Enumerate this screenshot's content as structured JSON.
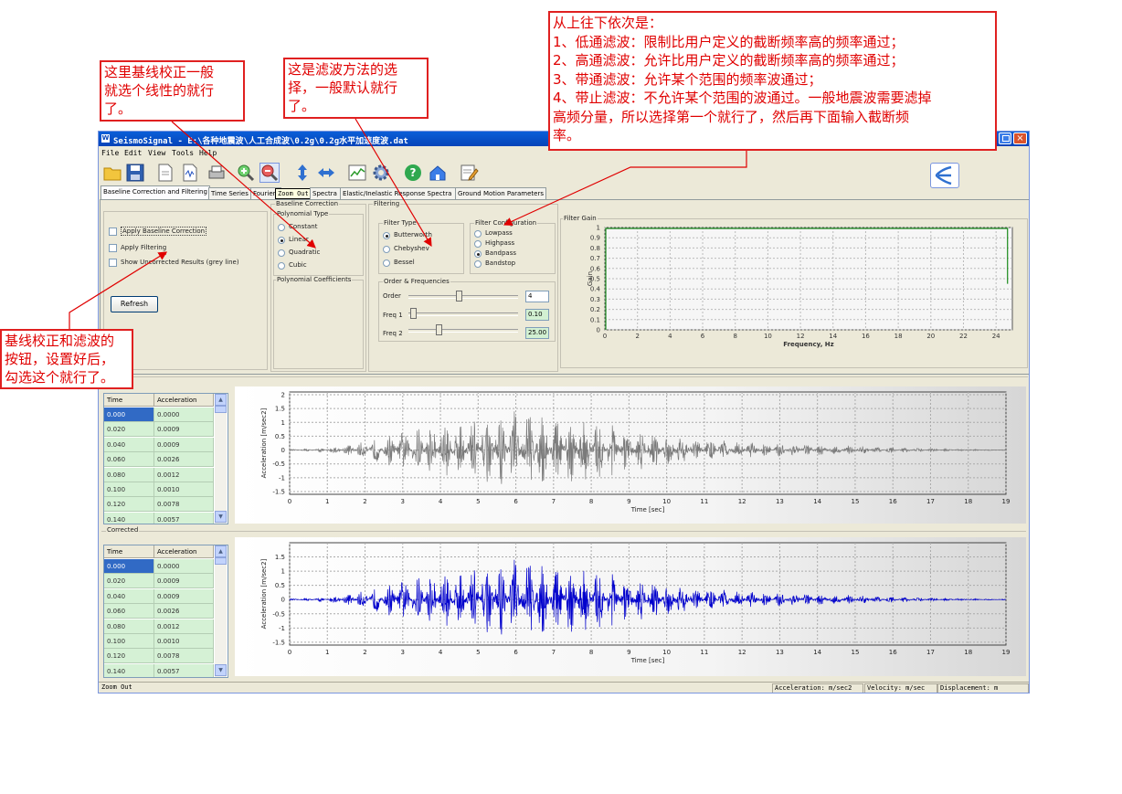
{
  "window": {
    "title": "SeismoSignal - E:\\各种地震波\\人工合成波\\0.2g\\0.2g水平加速度波.dat",
    "app_icon": "W"
  },
  "menu": [
    "File",
    "Edit",
    "View",
    "Tools",
    "Help"
  ],
  "toolbar_icons": [
    "open-folder-icon",
    "save-icon",
    "new-document-icon",
    "export-icon",
    "print-icon",
    "zoom-in-icon",
    "zoom-out-icon",
    "vertical-arrows-icon",
    "horizontal-arrows-icon",
    "chart-icon",
    "gear-icon",
    "help-icon",
    "home-icon",
    "notes-icon"
  ],
  "tabs": [
    "Baseline Correction and Filtering",
    "Time Series",
    "Fourier",
    "Zoom Out",
    "Spectra",
    "Elastic/Inelastic Response Spectra",
    "Ground Motion Parameters"
  ],
  "options": {
    "apply_baseline": "Apply Baseline Correction",
    "apply_filtering": "Apply Filtering",
    "show_uncorrected": "Show Uncorrected Results (grey line)",
    "refresh": "Refresh"
  },
  "baseline": {
    "group": "Baseline Correction",
    "poly_type": "Polynomial Type",
    "types": [
      "Constant",
      "Linear",
      "Quadratic",
      "Cubic"
    ],
    "selected": "Linear",
    "coefficients": "Polynomial Coefficients"
  },
  "filtering": {
    "group": "Filtering",
    "filter_type": "Filter Type",
    "types": [
      "Butterworth",
      "Chebyshev",
      "Bessel"
    ],
    "selected_type": "Butterworth",
    "config": "Filter Configuration",
    "configs": [
      "Lowpass",
      "Highpass",
      "Bandpass",
      "Bandstop"
    ],
    "selected_config": "Bandpass",
    "order_freq": "Order & Frequencies",
    "order_label": "Order",
    "order_value": "4",
    "freq1_label": "Freq 1",
    "freq1_value": "0.10",
    "freq2_label": "Freq 2",
    "freq2_value": "25.00"
  },
  "filter_gain": {
    "group": "Filter Gain",
    "ylabel": "Gain",
    "xlabel": "Frequency, Hz",
    "yticks": [
      "1",
      "0.9",
      "0.8",
      "0.7",
      "0.6",
      "0.5",
      "0.4",
      "0.3",
      "0.2",
      "0.1",
      "0"
    ],
    "xticks": [
      "0",
      "2",
      "4",
      "6",
      "8",
      "10",
      "12",
      "14",
      "16",
      "18",
      "20",
      "22",
      "24"
    ]
  },
  "table": {
    "headers": [
      "Time",
      "Acceleration"
    ],
    "rows": [
      [
        "0.000",
        "0.0000"
      ],
      [
        "0.020",
        "0.0009"
      ],
      [
        "0.040",
        "0.0009"
      ],
      [
        "0.060",
        "0.0026"
      ],
      [
        "0.080",
        "0.0012"
      ],
      [
        "0.100",
        "0.0010"
      ],
      [
        "0.120",
        "0.0078"
      ],
      [
        "0.140",
        "0.0057"
      ]
    ]
  },
  "corrected_label": "Corrected",
  "chart_data": [
    {
      "type": "line",
      "series_color": "#7a7a7a",
      "xlabel": "Time [sec]",
      "ylabel": "Acceleration [m/sec2]",
      "xlim": [
        0,
        19
      ],
      "ylim": [
        -1.6,
        2.1
      ],
      "xticks": [
        "0",
        "1",
        "2",
        "3",
        "4",
        "5",
        "6",
        "7",
        "8",
        "9",
        "10",
        "11",
        "12",
        "13",
        "14",
        "15",
        "16",
        "17",
        "18",
        "19"
      ],
      "yticks": [
        "2",
        "1.5",
        "1",
        "0.5",
        "0",
        "-0.5",
        "-1",
        "-1.5"
      ],
      "envelope": {
        "x": [
          0,
          1,
          2,
          3,
          4,
          5,
          6,
          7,
          8,
          9,
          10,
          11,
          12,
          13,
          14,
          15,
          16,
          17,
          18,
          19
        ],
        "amp": [
          0.02,
          0.08,
          0.3,
          0.7,
          1.0,
          1.2,
          1.5,
          1.2,
          1.1,
          0.8,
          0.6,
          0.4,
          0.3,
          0.25,
          0.2,
          0.15,
          0.1,
          0.06,
          0.03,
          0.01
        ]
      }
    },
    {
      "type": "line",
      "series_color": "#0000cc",
      "xlabel": "Time [sec]",
      "ylabel": "Acceleration [m/sec2]",
      "xlim": [
        0,
        19
      ],
      "ylim": [
        -1.6,
        2.0
      ],
      "xticks": [
        "0",
        "1",
        "2",
        "3",
        "4",
        "5",
        "6",
        "7",
        "8",
        "9",
        "10",
        "11",
        "12",
        "13",
        "14",
        "15",
        "16",
        "17",
        "18",
        "19"
      ],
      "yticks": [
        "1.5",
        "1",
        "0.5",
        "0",
        "-0.5",
        "-1",
        "-1.5"
      ],
      "envelope": {
        "x": [
          0,
          1,
          2,
          3,
          4,
          5,
          6,
          7,
          8,
          9,
          10,
          11,
          12,
          13,
          14,
          15,
          16,
          17,
          18,
          19
        ],
        "amp": [
          0.02,
          0.08,
          0.3,
          0.7,
          1.0,
          1.2,
          1.5,
          1.2,
          1.1,
          0.8,
          0.6,
          0.4,
          0.3,
          0.25,
          0.2,
          0.15,
          0.1,
          0.06,
          0.03,
          0.01
        ]
      }
    }
  ],
  "status": {
    "left": "Zoom Out",
    "accel": "Acceleration: m/sec2",
    "vel": "Velocity: m/sec",
    "disp": "Displacement: m"
  },
  "annotations": {
    "baseline_note": [
      "这里基线校正一般",
      "就选个线性的就行",
      "了。"
    ],
    "filter_method_note": [
      "这是滤波方法的选",
      "择，一般默认就行",
      "了。"
    ],
    "filter_config_note": [
      "从上往下依次是：",
      "1、低通滤波：限制比用户定义的截断频率高的频率通过；",
      "2、高通滤波：允许比用户定义的截断频率高的频率通过；",
      "3、带通滤波：允许某个范围的频率波通过；",
      "4、带止滤波：不允许某个范围的波通过。一般地震波需要滤掉",
      "高频分量，所以选择第一个就行了，然后再下面输入截断频",
      "率。"
    ],
    "button_note": [
      "基线校正和滤波的",
      "按钮，设置好后，",
      "勾选这个就行了。"
    ]
  },
  "colors": {
    "annotation": "#e00000",
    "titlebar": "#0a5fd8",
    "table_cell": "#d5f1d5"
  }
}
